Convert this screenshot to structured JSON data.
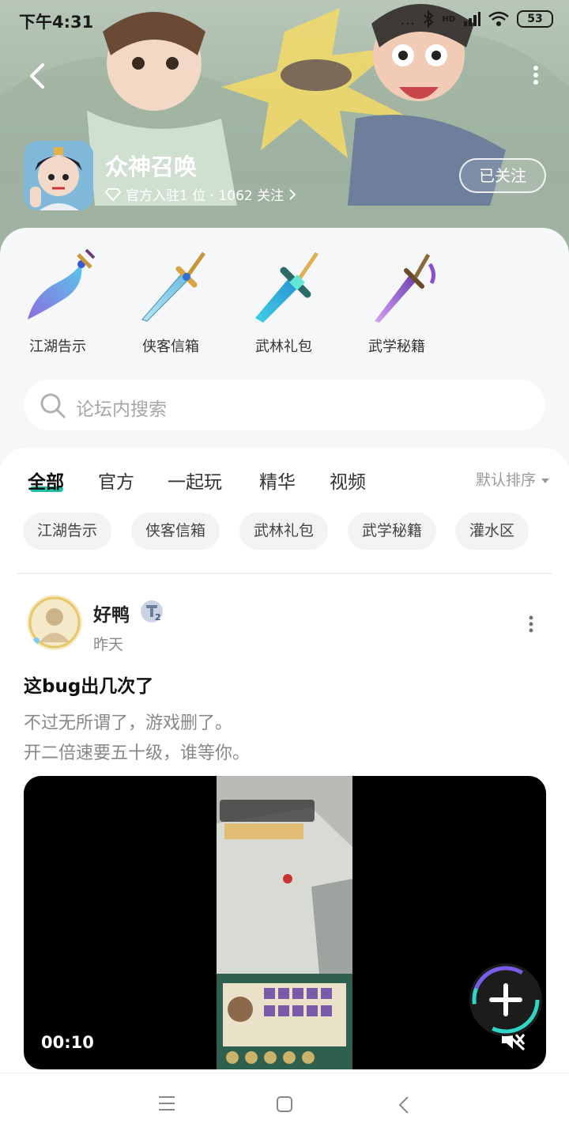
{
  "status_bar": {
    "time": "下午4:31",
    "signal_dots": "...",
    "hd": "HD",
    "battery": "53"
  },
  "header": {
    "game_name": "众神召唤",
    "meta_text": "官方入驻1 位 · 1062 关注",
    "follow_label": "已关注"
  },
  "categories": [
    {
      "label": "江湖告示",
      "icon": "curved-blade-icon"
    },
    {
      "label": "侠客信箱",
      "icon": "ice-sword-icon"
    },
    {
      "label": "武林礼包",
      "icon": "crystal-sword-icon"
    },
    {
      "label": "武学秘籍",
      "icon": "purple-sword-icon"
    }
  ],
  "search": {
    "placeholder": "论坛内搜索"
  },
  "tabs": [
    {
      "label": "全部",
      "active": true
    },
    {
      "label": "官方",
      "active": false
    },
    {
      "label": "一起玩",
      "active": false
    },
    {
      "label": "精华",
      "active": false
    },
    {
      "label": "视频",
      "active": false
    }
  ],
  "sort_label": "默认排序",
  "chips": [
    "江湖告示",
    "侠客信箱",
    "武林礼包",
    "武学秘籍",
    "灌水区"
  ],
  "post": {
    "username": "好鸭",
    "level": "2",
    "time": "昨天",
    "title": "这bug出几次了",
    "lines": [
      "不过无所谓了，游戏删了。",
      "开二倍速要五十级，谁等你。"
    ],
    "video_duration": "00:10"
  },
  "colors": {
    "accent": "#1ec0a8",
    "banner_bg": "#a9bba9",
    "panel_bg": "#f5f7f8"
  }
}
